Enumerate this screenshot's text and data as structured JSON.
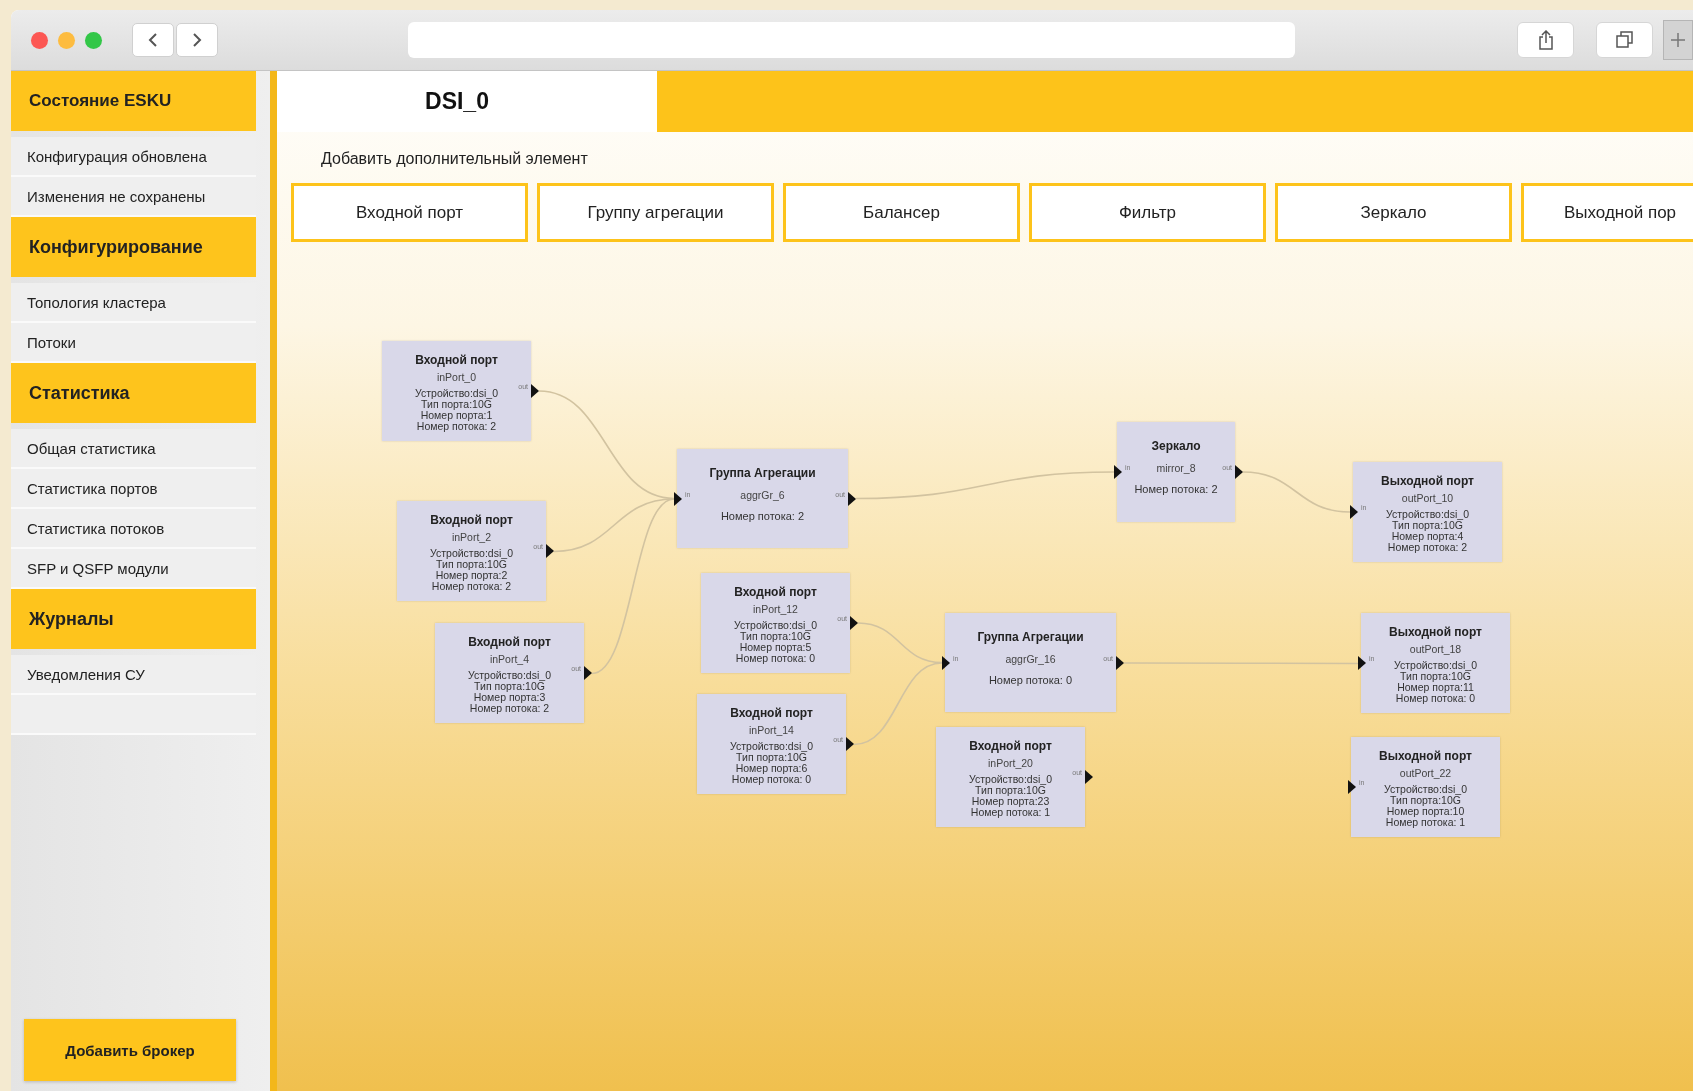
{
  "sidebar": {
    "sections": [
      {
        "title": "Состояние ESKU",
        "items": [
          {
            "label": "Конфигурация обновлена"
          },
          {
            "label": "Изменения не сохранены"
          }
        ]
      },
      {
        "title": "Конфигурирование",
        "items": [
          {
            "label": "Топология кластера"
          },
          {
            "label": "Потоки"
          }
        ]
      },
      {
        "title": "Статистика",
        "items": [
          {
            "label": "Общая статистика"
          },
          {
            "label": "Статистика портов"
          },
          {
            "label": "Статистика потоков"
          },
          {
            "label": "SFP и QSFP модули"
          }
        ]
      },
      {
        "title": "Журналы",
        "items": [
          {
            "label": "Уведомления СУ"
          }
        ]
      }
    ],
    "button": "Добавить брокер"
  },
  "tab": {
    "label": "DSI_0"
  },
  "add_element": {
    "label": "Добавить дополнительный элемент",
    "buttons": [
      "Входной порт",
      "Группу агрегации",
      "Балансер",
      "Фильтр",
      "Зеркало",
      "Выходной пор"
    ]
  },
  "nodes": [
    {
      "kind": "input",
      "title": "Входной порт",
      "name": "inPort_0",
      "details": [
        "Устройство:dsi_0",
        "Тип порта:10G",
        "Номер порта:1",
        "Номер потока: 2"
      ],
      "out": "out"
    },
    {
      "kind": "input",
      "title": "Входной порт",
      "name": "inPort_2",
      "details": [
        "Устройство:dsi_0",
        "Тип порта:10G",
        "Номер порта:2",
        "Номер потока: 2"
      ],
      "out": "out"
    },
    {
      "kind": "input",
      "title": "Входной порт",
      "name": "inPort_4",
      "details": [
        "Устройство:dsi_0",
        "Тип порта:10G",
        "Номер порта:3",
        "Номер потока: 2"
      ],
      "out": "out"
    },
    {
      "kind": "aggregation",
      "title": "Группа Агрегации",
      "name": "aggrGr_6",
      "details": [
        "Номер потока: 2"
      ],
      "in": "in",
      "out": "out"
    },
    {
      "kind": "input",
      "title": "Входной порт",
      "name": "inPort_12",
      "details": [
        "Устройство:dsi_0",
        "Тип порта:10G",
        "Номер порта:5",
        "Номер потока: 0"
      ],
      "out": "out"
    },
    {
      "kind": "input",
      "title": "Входной порт",
      "name": "inPort_14",
      "details": [
        "Устройство:dsi_0",
        "Тип порта:10G",
        "Номер порта:6",
        "Номер потока: 0"
      ],
      "out": "out"
    },
    {
      "kind": "aggregation",
      "title": "Группа Агрегации",
      "name": "aggrGr_16",
      "details": [
        "Номер потока: 0"
      ],
      "in": "in",
      "out": "out"
    },
    {
      "kind": "input",
      "title": "Входной порт",
      "name": "inPort_20",
      "details": [
        "Устройство:dsi_0",
        "Тип порта:10G",
        "Номер порта:23",
        "Номер потока: 1"
      ],
      "out": "out"
    },
    {
      "kind": "mirror",
      "title": "Зеркало",
      "name": "mirror_8",
      "details": [
        "Номер потока: 2"
      ],
      "in": "in",
      "out": "out"
    },
    {
      "kind": "output",
      "title": "Выходной порт",
      "name": "outPort_10",
      "details": [
        "Устройство:dsi_0",
        "Тип порта:10G",
        "Номер порта:4",
        "Номер потока: 2"
      ],
      "in": "in"
    },
    {
      "kind": "output",
      "title": "Выходной порт",
      "name": "outPort_18",
      "details": [
        "Устройство:dsi_0",
        "Тип порта:10G",
        "Номер порта:11",
        "Номер потока: 0"
      ],
      "in": "in"
    },
    {
      "kind": "output",
      "title": "Выходной порт",
      "name": "outPort_22",
      "details": [
        "Устройство:dsi_0",
        "Тип порта:10G",
        "Номер порта:10",
        "Номер потока: 1"
      ],
      "in": "in"
    }
  ]
}
